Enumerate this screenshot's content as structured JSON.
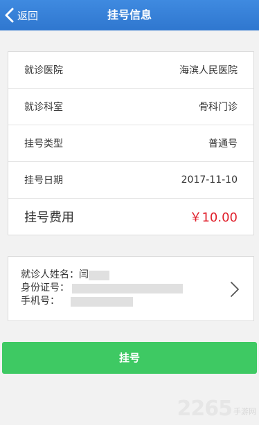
{
  "header": {
    "back_label": "返回",
    "title": "挂号信息"
  },
  "info": {
    "rows": [
      {
        "label": "就诊医院",
        "value": "海滨人民医院"
      },
      {
        "label": "就诊科室",
        "value": "骨科门诊"
      },
      {
        "label": "挂号类型",
        "value": "普通号"
      },
      {
        "label": "挂号日期",
        "value": "2017-11-10"
      }
    ],
    "fee_label": "挂号费用",
    "fee_value": "￥10.00"
  },
  "patient": {
    "name_label": "就诊人姓名：",
    "name_value": "闫",
    "id_label": "身份证号：",
    "phone_label": "手机号："
  },
  "register_button": "挂号",
  "watermark": {
    "logo": "2265",
    "suffix": "手游网"
  },
  "colors": {
    "header": "#2f77cf",
    "fee": "#e0202c",
    "button": "#3ec963"
  }
}
